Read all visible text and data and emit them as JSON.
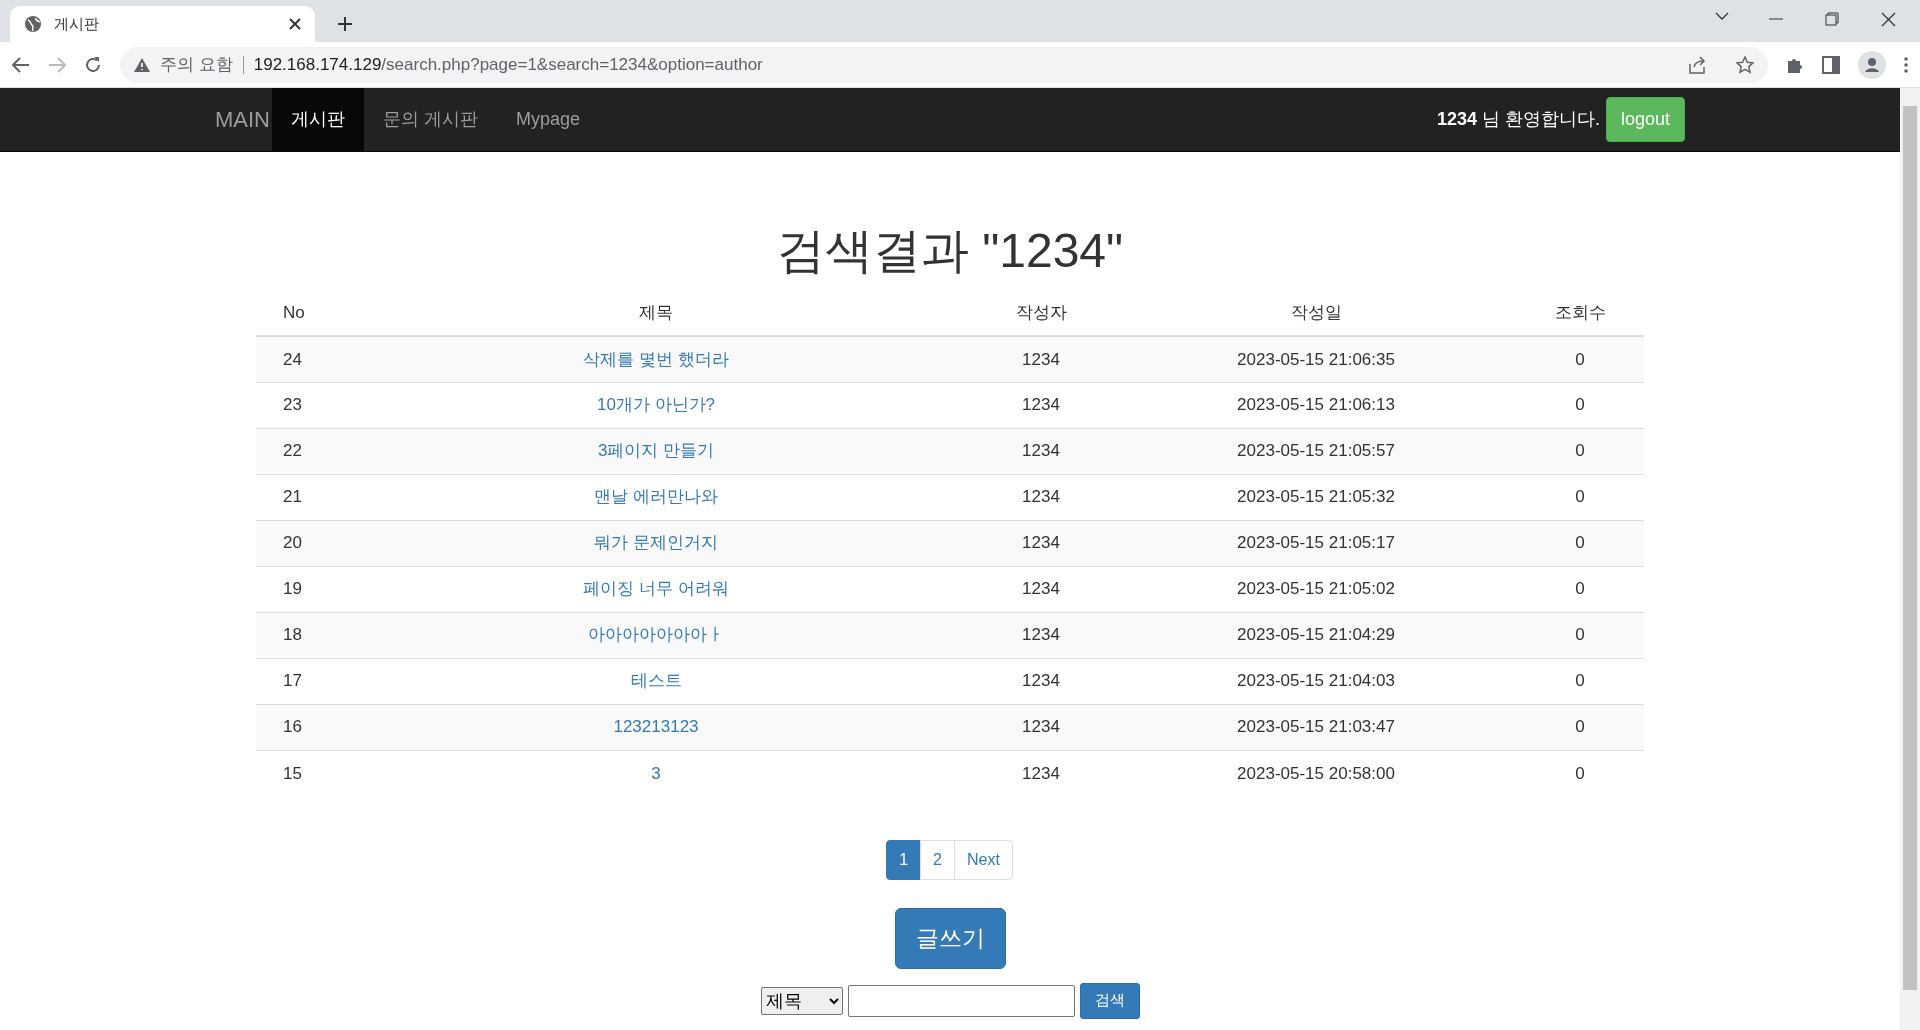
{
  "browser": {
    "tab_title": "게시판",
    "security": "주의 요함",
    "url_host": "192.168.174.129",
    "url_path": "/search.php?page=1&search=1234&option=author"
  },
  "navbar": {
    "brand": "MAIN",
    "items": [
      {
        "label": "게시판",
        "selected": true
      },
      {
        "label": "문의 게시판",
        "selected": false
      },
      {
        "label": "Mypage",
        "selected": false
      }
    ],
    "welcome": "**1234** 님 환영합니다.",
    "logout": "logout"
  },
  "heading": "검색결과 \"1234\"",
  "table": {
    "columns": [
      "No",
      "제목",
      "작성자",
      "작성일",
      "조회수"
    ],
    "rows": [
      {
        "no": "24",
        "title": "삭제를 몇번 했더라",
        "author": "1234",
        "date": "2023-05-15 21:06:35",
        "views": "0"
      },
      {
        "no": "23",
        "title": "10개가 아닌가?",
        "author": "1234",
        "date": "2023-05-15 21:06:13",
        "views": "0"
      },
      {
        "no": "22",
        "title": "3페이지 만들기",
        "author": "1234",
        "date": "2023-05-15 21:05:57",
        "views": "0"
      },
      {
        "no": "21",
        "title": "맨날 에러만나와",
        "author": "1234",
        "date": "2023-05-15 21:05:32",
        "views": "0"
      },
      {
        "no": "20",
        "title": "뭐가 문제인거지",
        "author": "1234",
        "date": "2023-05-15 21:05:17",
        "views": "0"
      },
      {
        "no": "19",
        "title": "페이징 너무 어려워",
        "author": "1234",
        "date": "2023-05-15 21:05:02",
        "views": "0"
      },
      {
        "no": "18",
        "title": "아아아아아아아ㅏ",
        "author": "1234",
        "date": "2023-05-15 21:04:29",
        "views": "0"
      },
      {
        "no": "17",
        "title": "테스트",
        "author": "1234",
        "date": "2023-05-15 21:04:03",
        "views": "0"
      },
      {
        "no": "16",
        "title": "123213123",
        "author": "1234",
        "date": "2023-05-15 21:03:47",
        "views": "0"
      },
      {
        "no": "15",
        "title": "3",
        "author": "1234",
        "date": "2023-05-15 20:58:00",
        "views": "0"
      }
    ]
  },
  "pagination": [
    {
      "label": "1",
      "selected": true
    },
    {
      "label": "2",
      "selected": false
    },
    {
      "label": "Next",
      "selected": false
    }
  ],
  "write_button": "글쓰기",
  "search": {
    "option": "제목",
    "button": "검색"
  }
}
